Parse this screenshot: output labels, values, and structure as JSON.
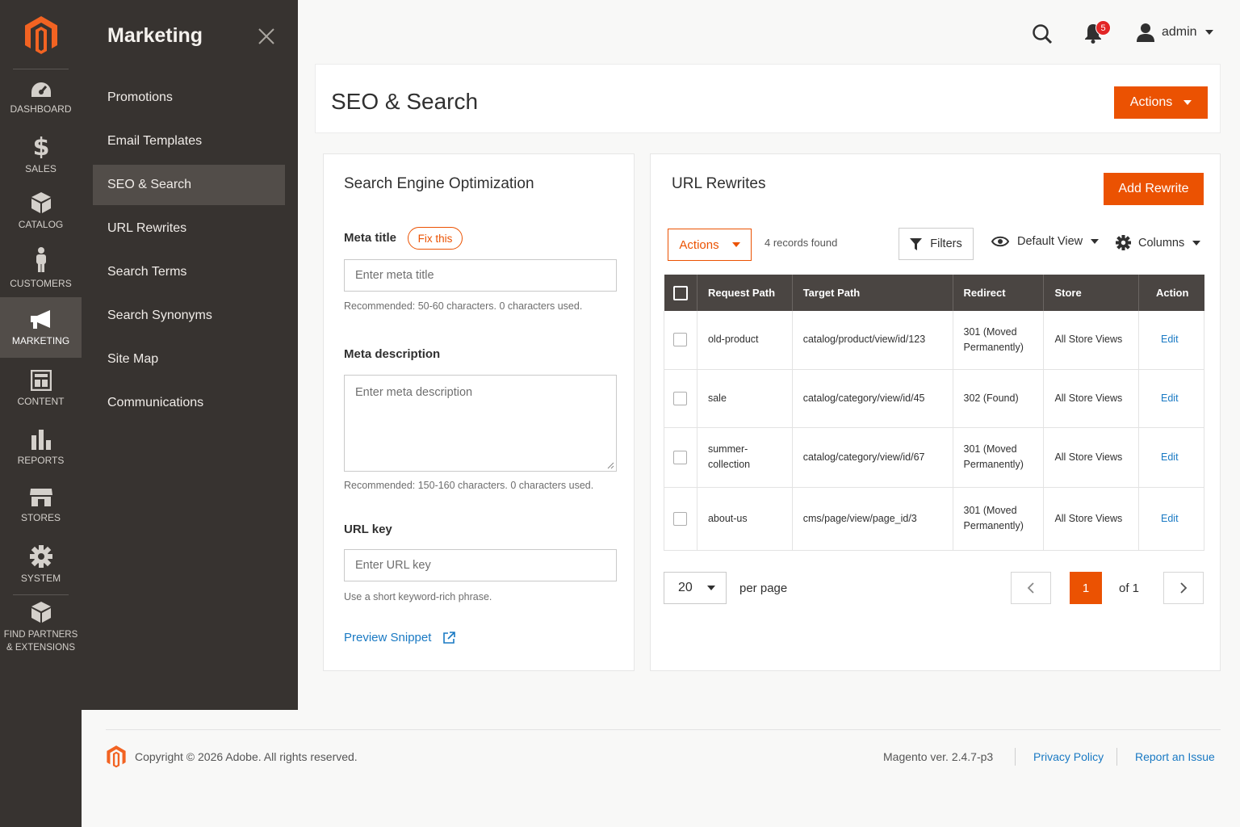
{
  "nav": {
    "items": [
      {
        "label": "DASHBOARD",
        "icon": "dashboard-icon"
      },
      {
        "label": "SALES",
        "icon": "dollar-icon"
      },
      {
        "label": "CATALOG",
        "icon": "box-icon"
      },
      {
        "label": "CUSTOMERS",
        "icon": "person-icon"
      },
      {
        "label": "MARKETING",
        "icon": "megaphone-icon",
        "active": true
      },
      {
        "label": "CONTENT",
        "icon": "layout-icon"
      },
      {
        "label": "REPORTS",
        "icon": "bar-chart-icon"
      },
      {
        "label": "STORES",
        "icon": "store-icon"
      },
      {
        "label": "SYSTEM",
        "icon": "gear-icon"
      }
    ],
    "partners_line1": "FIND PARTNERS",
    "partners_line2": "& EXTENSIONS"
  },
  "flyout": {
    "title": "Marketing",
    "items": [
      "Promotions",
      "Email Templates",
      "SEO & Search",
      "URL Rewrites",
      "Search Terms",
      "Search Synonyms",
      "Site Map",
      "Communications"
    ],
    "active": "SEO & Search"
  },
  "header": {
    "notifications": "5",
    "user": "admin"
  },
  "page": {
    "title": "SEO & Search",
    "actions_label": "Actions"
  },
  "seo": {
    "title": "Search Engine Optimization",
    "meta_title_label": "Meta title",
    "fix_label": "Fix this",
    "meta_title_placeholder": "Enter meta title",
    "meta_title_hint": "Recommended: 50-60 characters. 0 characters used.",
    "meta_desc_label": "Meta description",
    "meta_desc_placeholder": "Enter meta description",
    "meta_desc_hint": "Recommended: 150-160 characters. 0 characters used.",
    "url_key_label": "URL key",
    "url_key_placeholder": "Enter URL key",
    "url_key_hint": "Use a short keyword-rich phrase.",
    "preview_label": "Preview Snippet"
  },
  "rewrites": {
    "title": "URL Rewrites",
    "add_label": "Add Rewrite",
    "actions_label": "Actions",
    "records": "4 records found",
    "filters_label": "Filters",
    "view_label": "Default View",
    "columns_label": "Columns",
    "headers": [
      "Request Path",
      "Target Path",
      "Redirect",
      "Store",
      "Action"
    ],
    "rows": [
      {
        "request": "old-product",
        "target": "catalog/product/view/id/123",
        "redirect_1": "301 (Moved",
        "redirect_2": "Permanently)",
        "store": "All Store Views",
        "action": "Edit"
      },
      {
        "request": "sale",
        "target": "catalog/category/view/id/45",
        "redirect_1": "302 (Found)",
        "redirect_2": "",
        "store": "All Store Views",
        "action": "Edit"
      },
      {
        "request": "summer-collection",
        "target": "catalog/category/view/id/67",
        "redirect_1": "301 (Moved",
        "redirect_2": "Permanently)",
        "store": "All Store Views",
        "action": "Edit"
      },
      {
        "request": "about-us",
        "target": "cms/page/view/page_id/3",
        "redirect_1": "301 (Moved",
        "redirect_2": "Permanently)",
        "store": "All Store Views",
        "action": "Edit"
      }
    ],
    "per_page_value": "20",
    "per_page_label": "per page",
    "current_page": "1",
    "of_pages": "of 1"
  },
  "footer": {
    "copyright": "Copyright © 2026 Adobe. All rights reserved.",
    "version": "Magento ver. 2.4.7-p3",
    "privacy": "Privacy Policy",
    "report": "Report an Issue"
  },
  "colors": {
    "accent": "#eb5202",
    "nav_bg": "#373330",
    "link": "#1979c3"
  }
}
